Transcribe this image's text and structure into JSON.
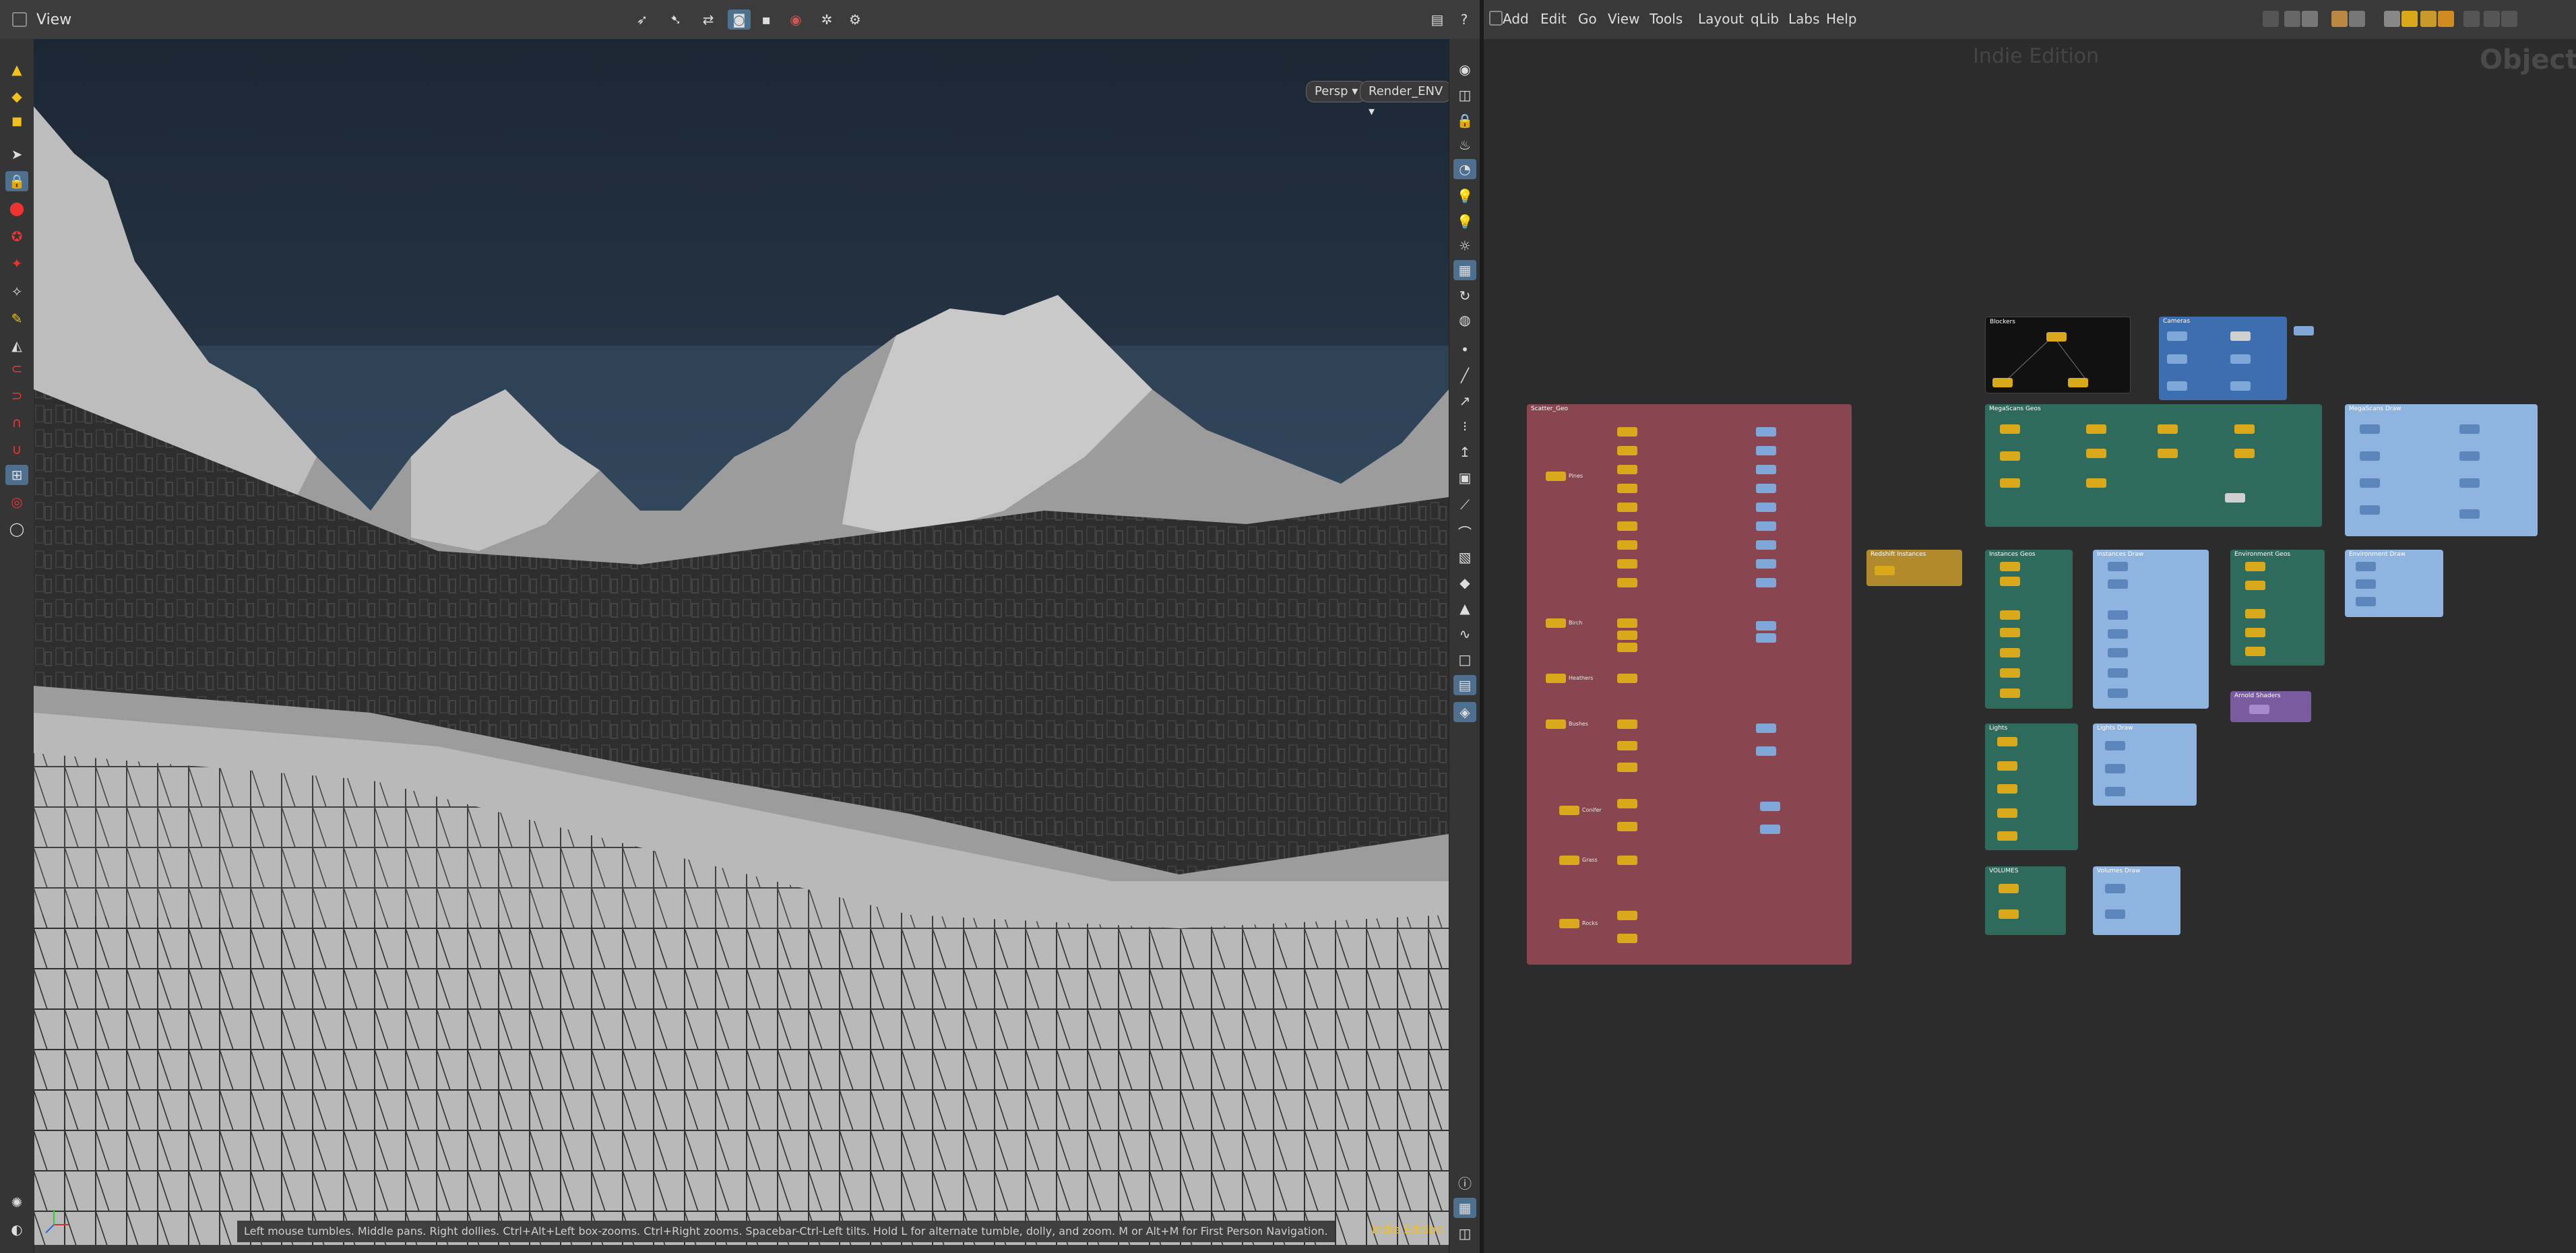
{
  "viewport_pane": {
    "tab_label": "View",
    "camera_button": "Persp",
    "render_button": "Render_ENV",
    "hint": "Left mouse tumbles. Middle pans. Right dollies. Ctrl+Alt+Left box-zooms. Ctrl+Right zooms. Spacebar-Ctrl-Left tilts. Hold L for alternate tumble, dolly, and zoom.    M or Alt+M for First Person Navigation.",
    "edition": "Indie Edition"
  },
  "network_pane": {
    "menu": [
      "Add",
      "Edit",
      "Go",
      "View",
      "Tools",
      "Layout",
      "qLib",
      "Labs",
      "Help"
    ],
    "watermark": "Indie Edition",
    "context": "Objects",
    "boxes": {
      "scatter": "Scatter_Geo",
      "blockers": "Blockers",
      "cameras": "Cameras",
      "megascans": "MegaScans Geos",
      "megascans_draw": "MegaScans Draw",
      "redshift": "Redshift Instances",
      "instances": "Instances Geos",
      "instances_draw": "Instances Draw",
      "env": "Environment Geos",
      "env_draw": "Environment Draw",
      "arnold": "Arnold Shaders",
      "lights": "Lights",
      "lights_draw": "Lights Draw",
      "volumes": "VOLUMES",
      "volumes_draw": "Volumes Draw"
    },
    "scatter_nodes": [
      "Pines",
      "Birch",
      "Heathers",
      "Bushes",
      "Conifer",
      "Grass",
      "Rocks"
    ]
  },
  "colors": {
    "scatter_box": "#8a4650",
    "megascans_box": "#2f6b5c",
    "draw_box": "#8fb4e0",
    "node_yellow": "#d9a81b",
    "node_blue": "#7fa8d8",
    "arnold_box": "#7a5aa0",
    "redshift_box": "#b08a2c",
    "edition_text": "#f2c11d"
  }
}
